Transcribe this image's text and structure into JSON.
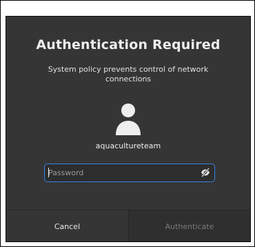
{
  "dialog": {
    "title": "Authentication Required",
    "message": "System policy prevents control of network connections",
    "username": "aquacultureteam",
    "avatar_icon": "user-avatar-icon",
    "password": {
      "placeholder": "Password",
      "value": "",
      "reveal_icon": "eye-slash-icon"
    },
    "buttons": {
      "cancel": "Cancel",
      "authenticate": "Authenticate"
    }
  },
  "colors": {
    "dialog_background": "#353535",
    "focus_accent": "#3584e4",
    "disabled_text": "#7b7b7b"
  }
}
